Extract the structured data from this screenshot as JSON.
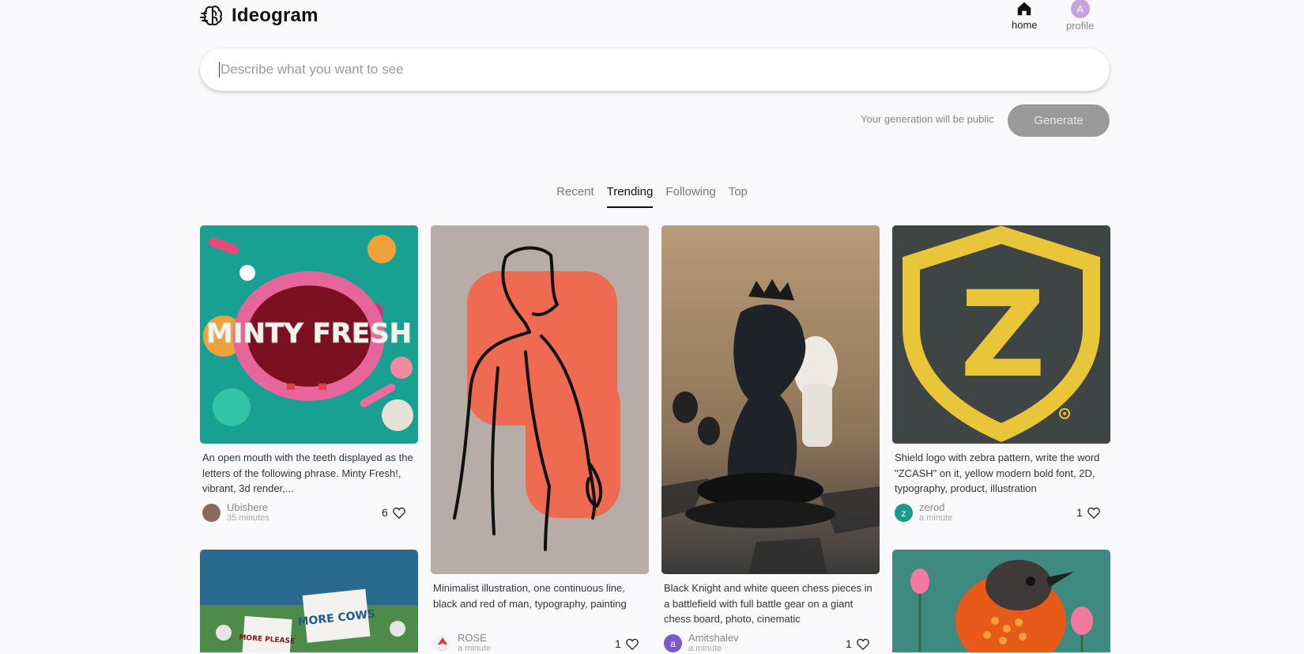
{
  "header": {
    "brand": "Ideogram",
    "nav": {
      "home": "home",
      "profile": "profile",
      "avatar_letter": "A"
    }
  },
  "search": {
    "placeholder": "Describe what you want to see"
  },
  "generate": {
    "note": "Your generation will be public",
    "button": "Generate"
  },
  "tabs": [
    "Recent",
    "Trending",
    "Following",
    "Top"
  ],
  "active_tab": "Trending",
  "cards": [
    {
      "image_text": "MINTY FRESH",
      "description": "An open mouth with the teeth displayed as the letters of the following phrase. Minty Fresh!, vibrant, 3d render,...",
      "user": "Ubishere",
      "time": "35 minutes",
      "likes": "6"
    },
    {
      "description": "Minimalist illustration, one continuous line, black and red of man, typography, painting",
      "user": "ROSE",
      "time": "a minute",
      "likes": "1"
    },
    {
      "description": "Black Knight and white queen chess pieces in a battlefield with full battle gear on a giant chess board, photo, cinematic",
      "user": "Amitshalev",
      "avatar_letter": "a",
      "time": "a minute",
      "likes": "1"
    },
    {
      "image_text": "Z",
      "description": "Shield logo with zebra pattern, write the word \"ZCASH\" on it, yellow modern bold font, 2D, typography, product, illustration",
      "user": "zerod",
      "avatar_letter": "z",
      "time": "a minute",
      "likes": "1"
    },
    {
      "sign_text_1": "MORE COWS",
      "sign_text_2": "MORE PLEASE"
    },
    {}
  ],
  "colors": {
    "accent": "#111111",
    "button_disabled": "#9a9a9a",
    "teal": "#1a9a8c",
    "shield_yellow": "#e9c53a"
  }
}
